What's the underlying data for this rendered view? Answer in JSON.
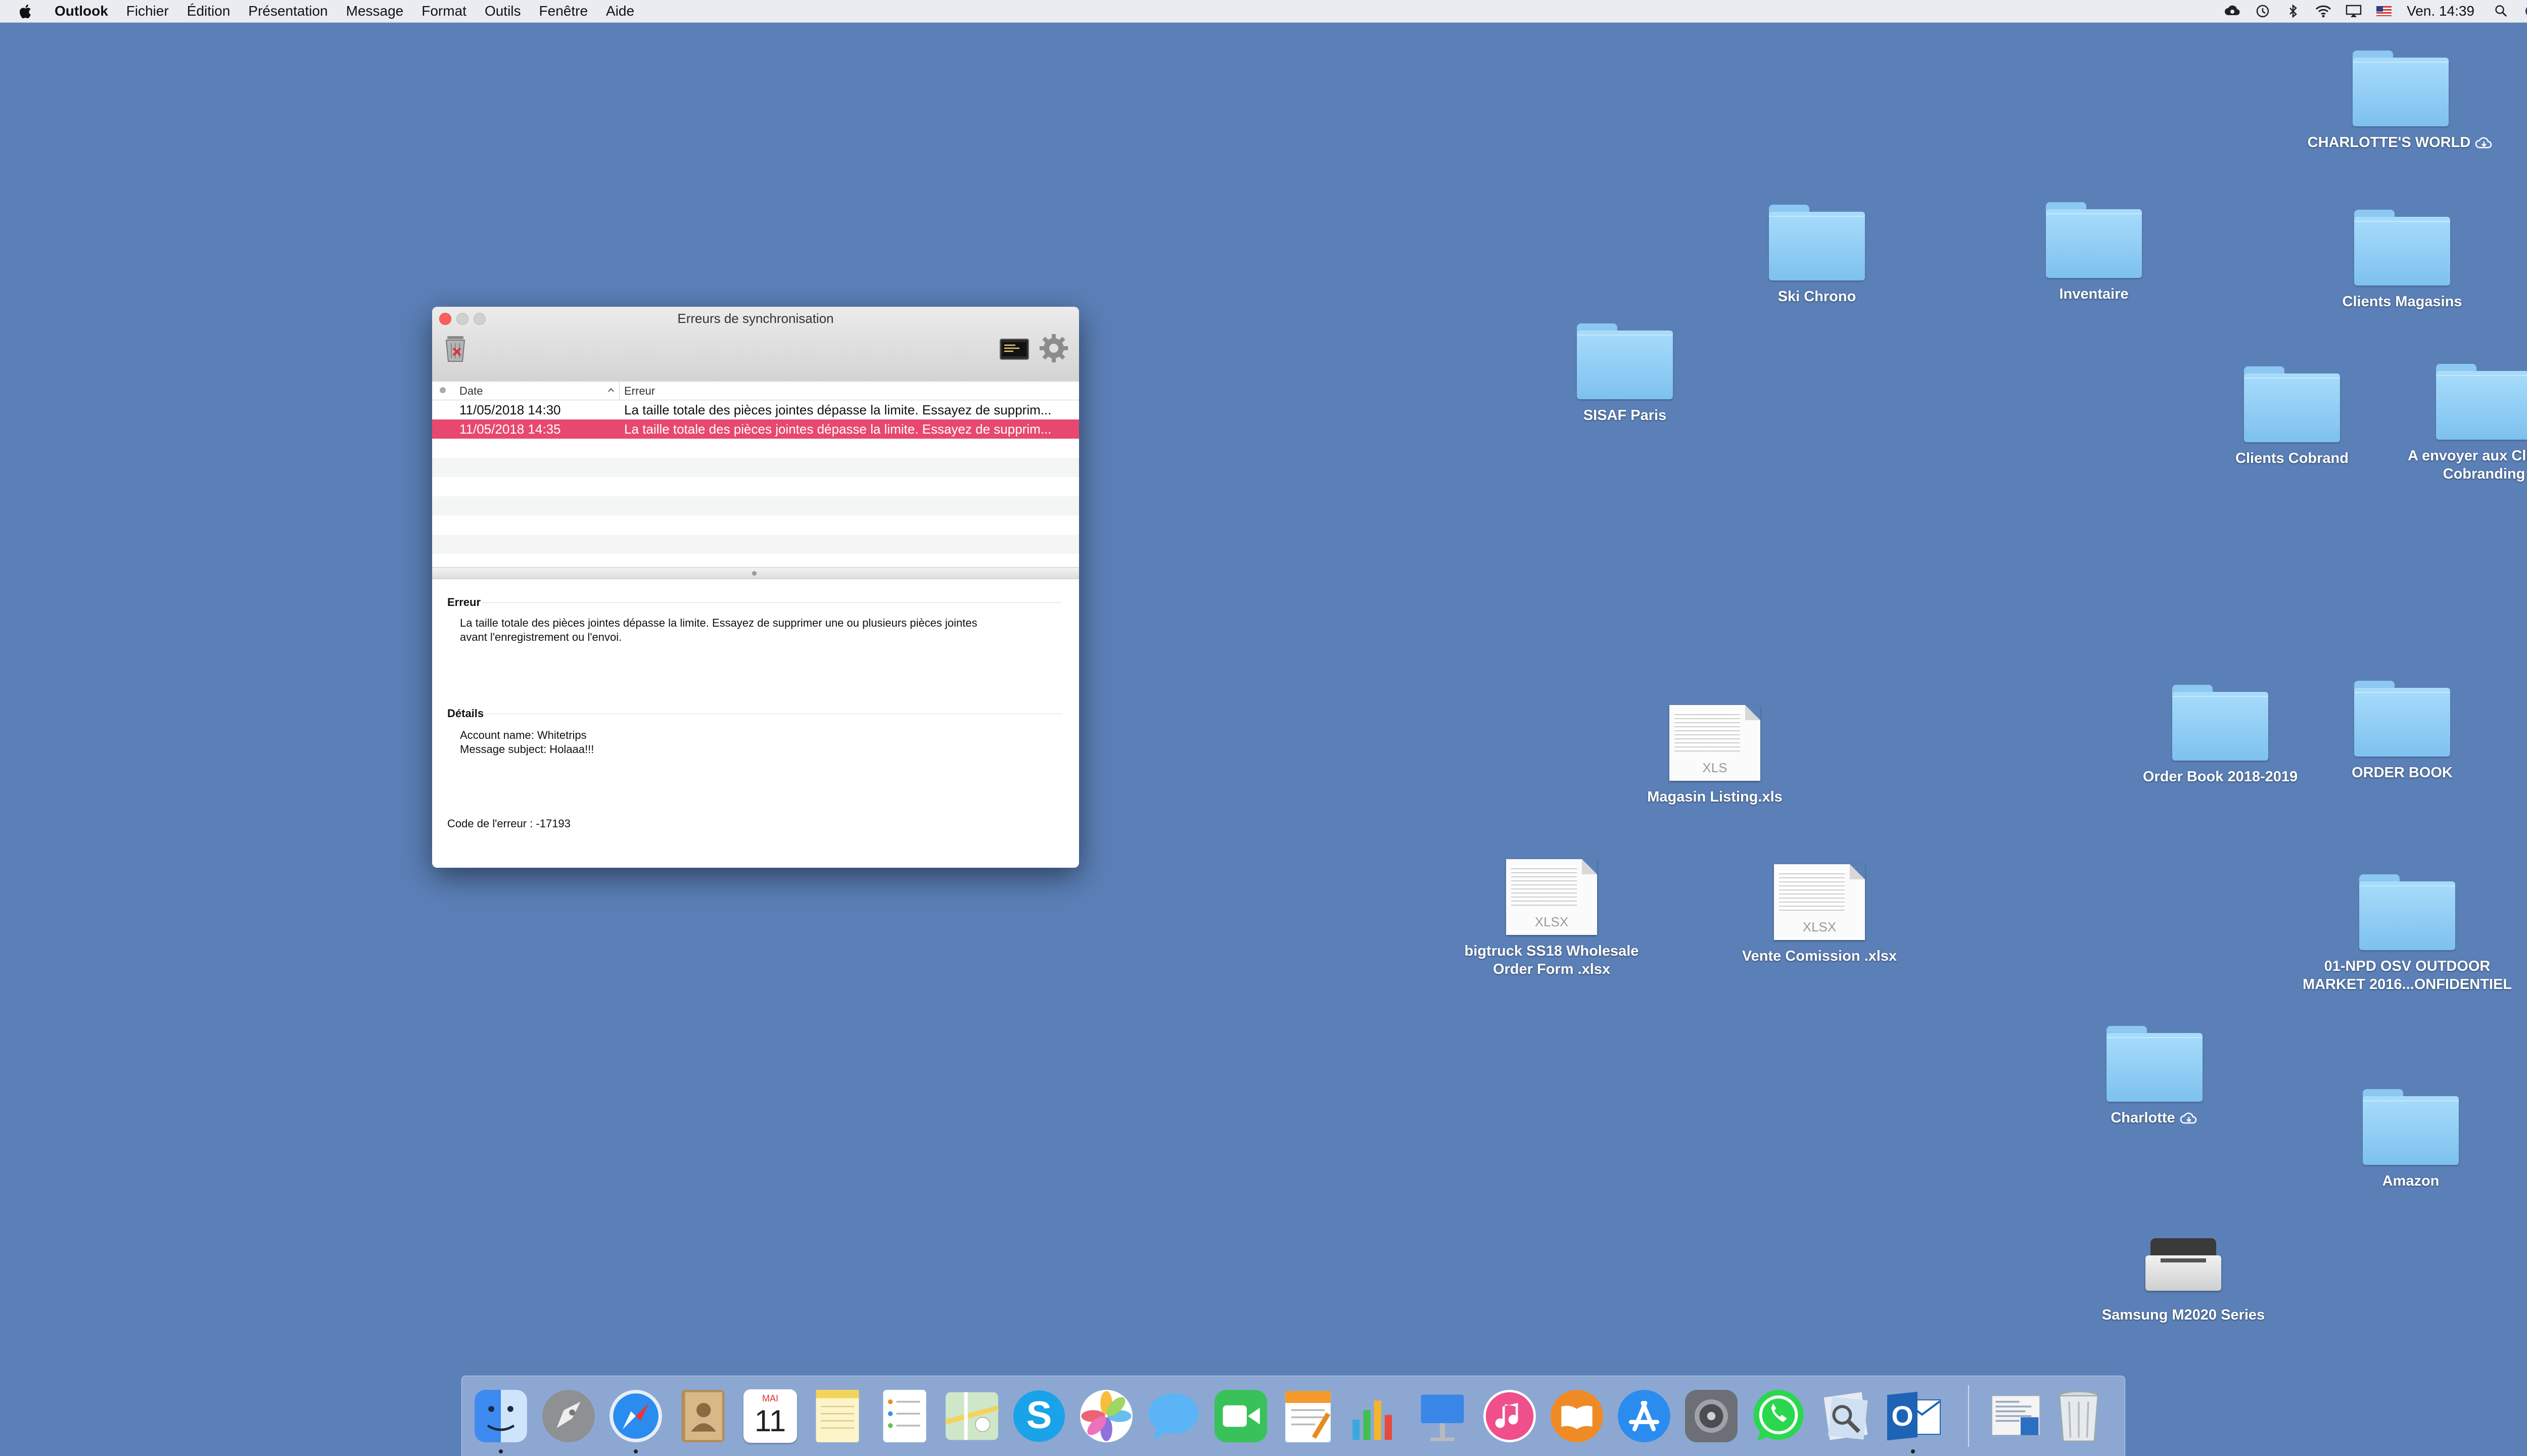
{
  "menubar": {
    "app_name": "Outlook",
    "items": [
      "Fichier",
      "Édition",
      "Présentation",
      "Message",
      "Format",
      "Outils",
      "Fenêtre",
      "Aide"
    ],
    "status_icons": [
      "creative-cloud-icon",
      "time-machine-icon",
      "bluetooth-icon",
      "wifi-icon",
      "airplay-icon",
      "us-flag-icon"
    ],
    "clock": "Ven. 14:39",
    "right_icons": [
      "spotlight-icon",
      "siri-icon",
      "notification-center-icon"
    ]
  },
  "desktop": {
    "charlottes_world": "CHARLOTTE'S WORLD",
    "ski_chrono": "Ski Chrono",
    "inventaire": "Inventaire",
    "clients_magasins": "Clients Magasins",
    "sisaf_paris": "SISAF Paris",
    "clients_cobrand": "Clients Cobrand",
    "a_envoyer_line1": "A envoyer aux Clients",
    "a_envoyer_line2": "Cobranding",
    "magasin_listing": "Magasin Listing.xls",
    "magasin_ext": "XLS",
    "order_book_2018": "Order Book 2018-2019",
    "order_book": "ORDER BOOK",
    "bigtruck_line1": "bigtruck SS18 Wholesale",
    "bigtruck_line2": "Order Form .xlsx",
    "bigtruck_ext": "XLSX",
    "vente_comission": "Vente Comission .xlsx",
    "vente_ext": "XLSX",
    "npd_line1": "01-NPD OSV OUTDOOR",
    "npd_line2": "MARKET 2016...ONFIDENTIEL",
    "charlotte": "Charlotte",
    "amazon": "Amazon",
    "samsung": "Samsung M2020 Series"
  },
  "window": {
    "title": "Erreurs de synchronisation",
    "col_date": "Date",
    "col_error": "Erreur",
    "rows": [
      {
        "date": "11/05/2018 14:30",
        "error": "La taille totale des pièces jointes dépasse la limite. Essayez de supprim..."
      },
      {
        "date": "11/05/2018 14:35",
        "error": "La taille totale des pièces jointes dépasse la limite. Essayez de supprim..."
      }
    ],
    "error_title": "Erreur",
    "error_line1": "La taille totale des pièces jointes dépasse la limite. Essayez de supprimer une ou plusieurs pièces jointes",
    "error_line2": "avant l'enregistrement ou l'envoi.",
    "details_title": "Détails",
    "account_name": "Account name: Whitetrips",
    "message_subject": "Message subject: Holaaa!!!",
    "error_code": "Code de l'erreur : -17193"
  },
  "dock": {
    "apps": [
      "finder-icon",
      "launchpad-icon",
      "safari-icon",
      "contacts-icon",
      "calendar-icon",
      "notes-icon",
      "reminders-icon",
      "maps-icon",
      "skype-icon",
      "photos-icon",
      "messages-icon",
      "facetime-icon",
      "pages-icon",
      "numbers-icon",
      "keynote-icon",
      "itunes-icon",
      "ibooks-icon",
      "app-store-icon",
      "system-preferences-icon",
      "whatsapp-icon",
      "preview-icon",
      "outlook-icon"
    ],
    "calendar_month": "MAI",
    "calendar_day": "11",
    "outlook_letter": "O",
    "skype_letter": "S"
  },
  "colors": {
    "desktop": "#5b80b8",
    "selection": "#e8486f",
    "folder": "#8fcdf5"
  }
}
